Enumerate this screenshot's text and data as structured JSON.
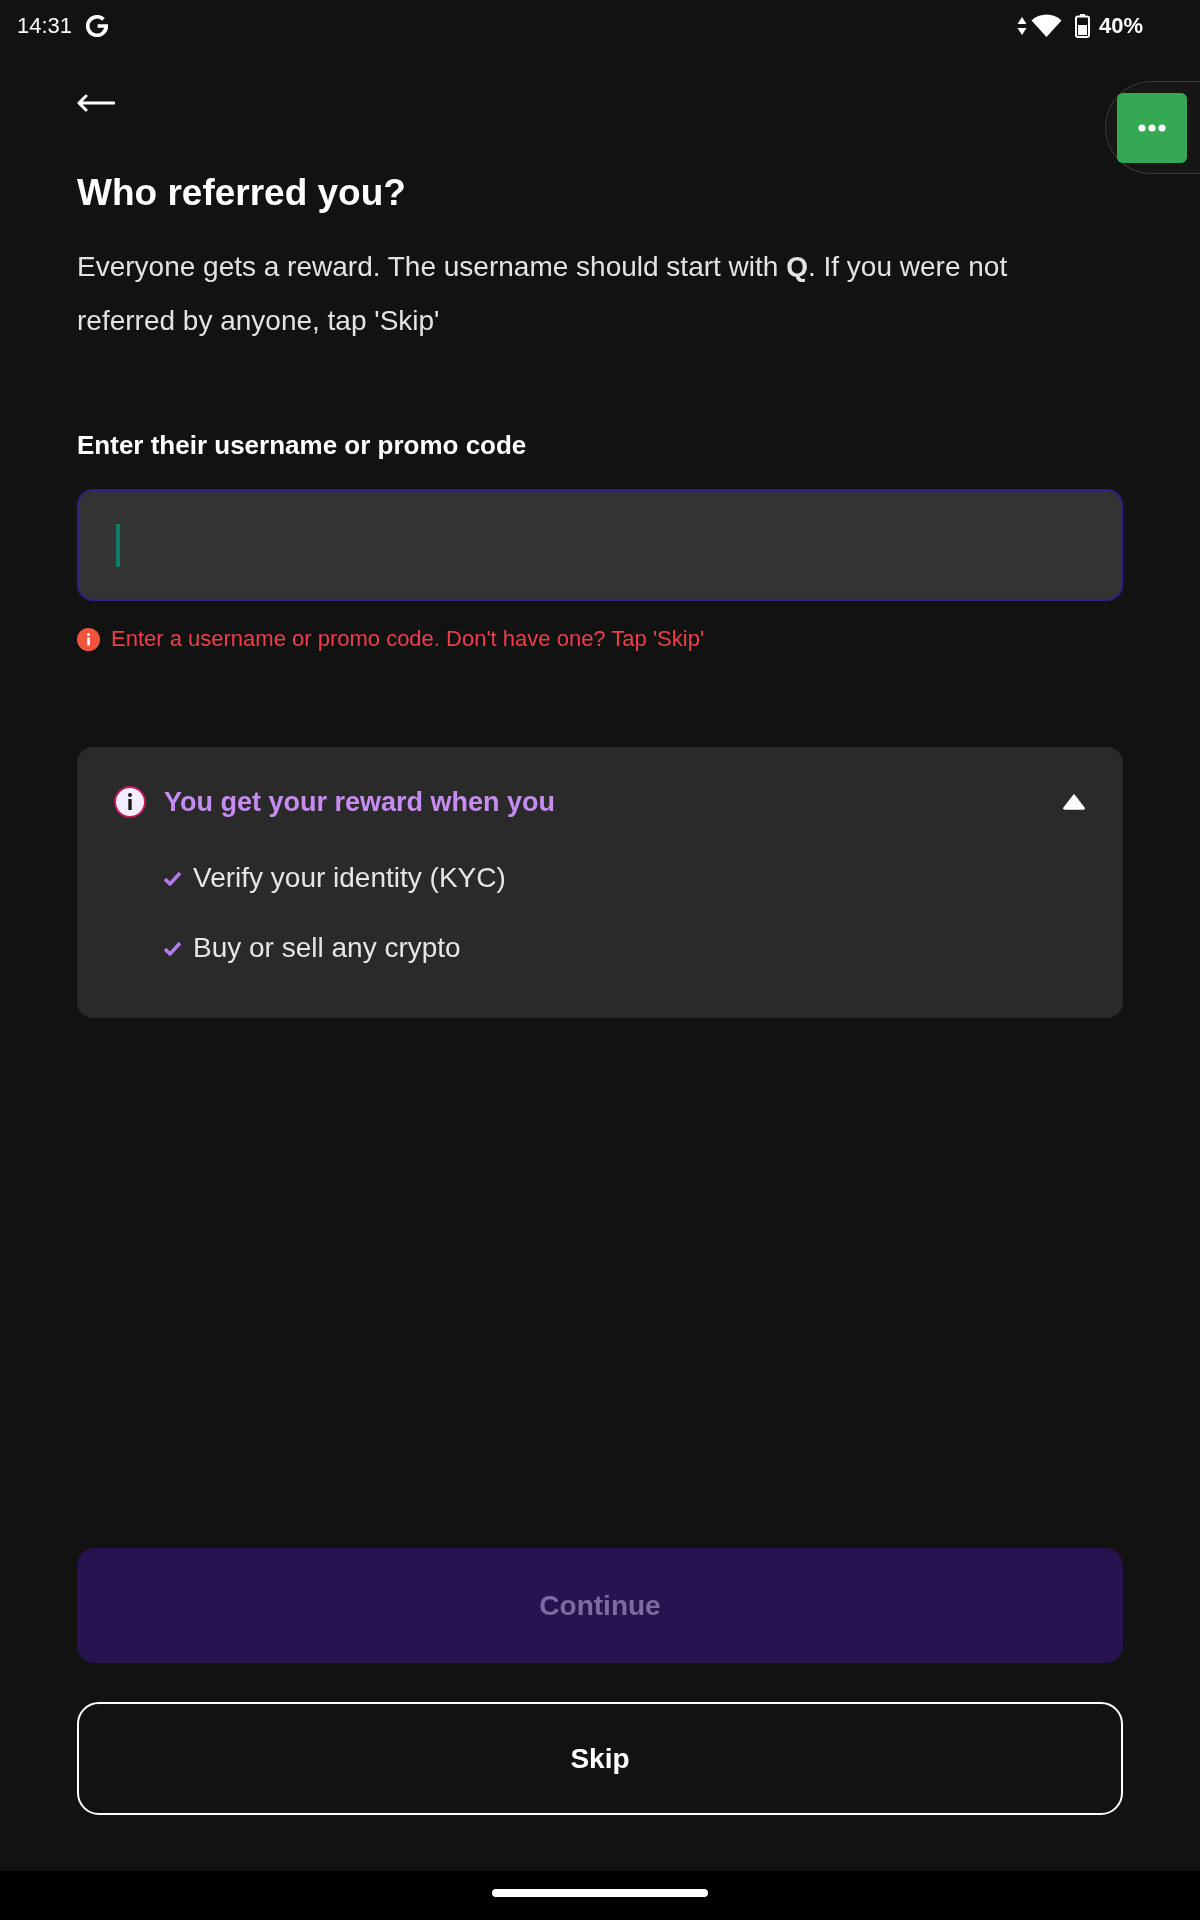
{
  "status_bar": {
    "time": "14:31",
    "battery": "40%"
  },
  "title": "Who referred you?",
  "description": "Everyone gets a reward. The username should start with **Q**. If you were not referred by anyone, tap 'Skip'",
  "referral_field": {
    "label": "Enter their username or promo code",
    "focused": true,
    "error": "Enter a username or promo code. Don't have one? Tap 'Skip'"
  },
  "reward_info": {
    "title": "You get your reward when you",
    "expanded": true,
    "items": [
      "Verify your identity (KYC)",
      "Buy or sell any crypto"
    ]
  },
  "buttons": [
    {
      "label": "Continue",
      "kind": "primary",
      "disabled": true
    },
    {
      "label": "Skip",
      "kind": "outline",
      "disabled": false
    }
  ]
}
